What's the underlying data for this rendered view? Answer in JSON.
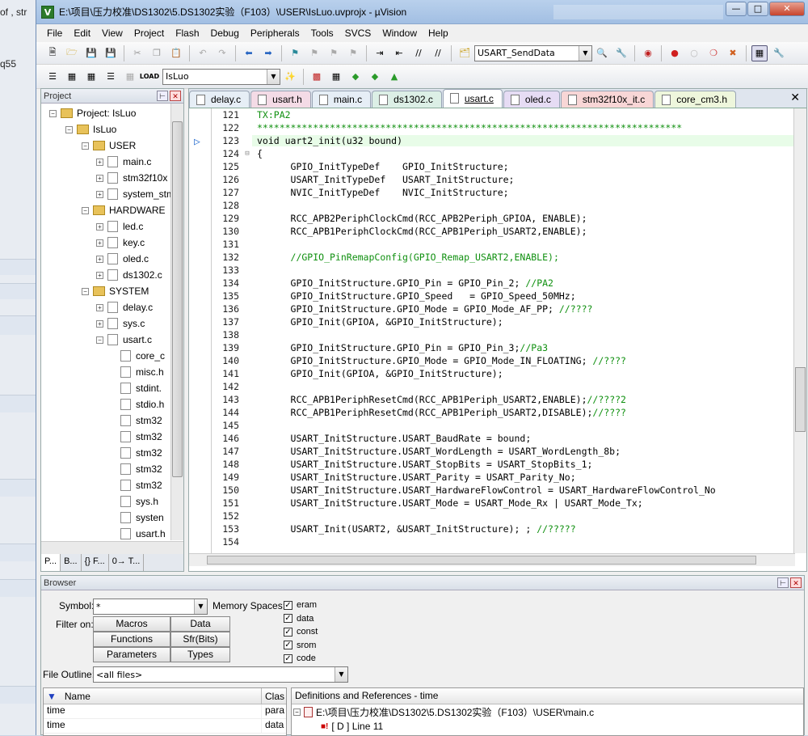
{
  "background": {
    "frag_of": "of , str",
    "frag_q55": "q55"
  },
  "title": "E:\\项目\\压力校准\\DS1302\\5.DS1302实验（F103）\\USER\\IsLuo.uvprojx - µVision",
  "menu": [
    "File",
    "Edit",
    "View",
    "Project",
    "Flash",
    "Debug",
    "Peripherals",
    "Tools",
    "SVCS",
    "Window",
    "Help"
  ],
  "toolbar": {
    "find_combo": "USART_SendData",
    "target_combo": "IsLuo"
  },
  "project_pane": {
    "title": "Project",
    "tree": [
      {
        "label": "Project: IsLuo",
        "level": 0,
        "kind": "project"
      },
      {
        "label": "IsLuo",
        "level": 1,
        "kind": "target"
      },
      {
        "label": "USER",
        "level": 2,
        "kind": "group"
      },
      {
        "label": "main.c",
        "level": 3,
        "kind": "file"
      },
      {
        "label": "stm32f10x",
        "level": 3,
        "kind": "file"
      },
      {
        "label": "system_stm",
        "level": 3,
        "kind": "file"
      },
      {
        "label": "HARDWARE",
        "level": 2,
        "kind": "group"
      },
      {
        "label": "led.c",
        "level": 3,
        "kind": "file"
      },
      {
        "label": "key.c",
        "level": 3,
        "kind": "file"
      },
      {
        "label": "oled.c",
        "level": 3,
        "kind": "file"
      },
      {
        "label": "ds1302.c",
        "level": 3,
        "kind": "file"
      },
      {
        "label": "SYSTEM",
        "level": 2,
        "kind": "group"
      },
      {
        "label": "delay.c",
        "level": 3,
        "kind": "file"
      },
      {
        "label": "sys.c",
        "level": 3,
        "kind": "file"
      },
      {
        "label": "usart.c",
        "level": 3,
        "kind": "file-open"
      },
      {
        "label": "core_c",
        "level": 4,
        "kind": "header"
      },
      {
        "label": "misc.h",
        "level": 4,
        "kind": "header"
      },
      {
        "label": "stdint.",
        "level": 4,
        "kind": "header"
      },
      {
        "label": "stdio.h",
        "level": 4,
        "kind": "header"
      },
      {
        "label": "stm32",
        "level": 4,
        "kind": "header"
      },
      {
        "label": "stm32",
        "level": 4,
        "kind": "header"
      },
      {
        "label": "stm32",
        "level": 4,
        "kind": "header"
      },
      {
        "label": "stm32",
        "level": 4,
        "kind": "header"
      },
      {
        "label": "stm32",
        "level": 4,
        "kind": "header"
      },
      {
        "label": "sys.h",
        "level": 4,
        "kind": "header"
      },
      {
        "label": "systen",
        "level": 4,
        "kind": "header"
      },
      {
        "label": "usart.h",
        "level": 4,
        "kind": "header"
      }
    ],
    "bottom_tabs": [
      "P...",
      "B...",
      "{} F...",
      "0→ T..."
    ]
  },
  "editor": {
    "tabs": [
      {
        "label": "delay.c",
        "color": "#e6eef6"
      },
      {
        "label": "usart.h",
        "color": "#f4dbe6"
      },
      {
        "label": "main.c",
        "color": "#e6eef6"
      },
      {
        "label": "ds1302.c",
        "color": "#dcefe6"
      },
      {
        "label": "usart.c",
        "color": "#ffffff",
        "active": true
      },
      {
        "label": "oled.c",
        "color": "#e6dcf4"
      },
      {
        "label": "stm32f10x_it.c",
        "color": "#f8d6d6"
      },
      {
        "label": "core_cm3.h",
        "color": "#eef6dc"
      }
    ],
    "lines": [
      {
        "n": "121",
        "t": "TX:PA2",
        "c": "cmt"
      },
      {
        "n": "122",
        "t": "****************************************************************************",
        "c": "cmt"
      },
      {
        "n": "123",
        "t": "void uart2_init(u32 bound)",
        "c": "",
        "hl": true
      },
      {
        "n": "124",
        "t": "{",
        "c": "",
        "fold": true
      },
      {
        "n": "125",
        "t": "      GPIO_InitTypeDef    GPIO_InitStructure;",
        "c": ""
      },
      {
        "n": "126",
        "t": "      USART_InitTypeDef   USART_InitStructure;",
        "c": ""
      },
      {
        "n": "127",
        "t": "      NVIC_InitTypeDef    NVIC_InitStructure;",
        "c": ""
      },
      {
        "n": "128",
        "t": "",
        "c": ""
      },
      {
        "n": "129",
        "t": "      RCC_APB2PeriphClockCmd(RCC_APB2Periph_GPIOA, ENABLE);",
        "c": ""
      },
      {
        "n": "130",
        "t": "      RCC_APB1PeriphClockCmd(RCC_APB1Periph_USART2,ENABLE);",
        "c": ""
      },
      {
        "n": "131",
        "t": "",
        "c": ""
      },
      {
        "n": "132",
        "t": "      //GPIO_PinRemapConfig(GPIO_Remap_USART2,ENABLE);",
        "c": "cmt"
      },
      {
        "n": "133",
        "t": "",
        "c": ""
      },
      {
        "n": "134",
        "t": "      GPIO_InitStructure.GPIO_Pin = GPIO_Pin_2; ",
        "c": "",
        "tail": "//PA2"
      },
      {
        "n": "135",
        "t": "      GPIO_InitStructure.GPIO_Speed   = GPIO_Speed_50MHz;",
        "c": ""
      },
      {
        "n": "136",
        "t": "      GPIO_InitStructure.GPIO_Mode = GPIO_Mode_AF_PP; ",
        "c": "",
        "tail": "//????"
      },
      {
        "n": "137",
        "t": "      GPIO_Init(GPIOA, &GPIO_InitStructure);",
        "c": ""
      },
      {
        "n": "138",
        "t": "",
        "c": ""
      },
      {
        "n": "139",
        "t": "      GPIO_InitStructure.GPIO_Pin = GPIO_Pin_3;",
        "c": "",
        "tail": "//Pa3"
      },
      {
        "n": "140",
        "t": "      GPIO_InitStructure.GPIO_Mode = GPIO_Mode_IN_FLOATING; ",
        "c": "",
        "tail": "//????"
      },
      {
        "n": "141",
        "t": "      GPIO_Init(GPIOA, &GPIO_InitStructure);",
        "c": ""
      },
      {
        "n": "142",
        "t": "",
        "c": ""
      },
      {
        "n": "143",
        "t": "      RCC_APB1PeriphResetCmd(RCC_APB1Periph_USART2,ENABLE);",
        "c": "",
        "tail": "//????2"
      },
      {
        "n": "144",
        "t": "      RCC_APB1PeriphResetCmd(RCC_APB1Periph_USART2,DISABLE);",
        "c": "",
        "tail": "//????"
      },
      {
        "n": "145",
        "t": "",
        "c": ""
      },
      {
        "n": "146",
        "t": "      USART_InitStructure.USART_BaudRate = bound;",
        "c": ""
      },
      {
        "n": "147",
        "t": "      USART_InitStructure.USART_WordLength = USART_WordLength_8b;",
        "c": ""
      },
      {
        "n": "148",
        "t": "      USART_InitStructure.USART_StopBits = USART_StopBits_1;",
        "c": ""
      },
      {
        "n": "149",
        "t": "      USART_InitStructure.USART_Parity = USART_Parity_No;",
        "c": ""
      },
      {
        "n": "150",
        "t": "      USART_InitStructure.USART_HardwareFlowControl = USART_HardwareFlowControl_No",
        "c": ""
      },
      {
        "n": "151",
        "t": "      USART_InitStructure.USART_Mode = USART_Mode_Rx | USART_Mode_Tx;",
        "c": ""
      },
      {
        "n": "152",
        "t": "",
        "c": ""
      },
      {
        "n": "153",
        "t": "      USART_Init(USART2, &USART_InitStructure); ; ",
        "c": "",
        "tail": "//?????"
      },
      {
        "n": "154",
        "t": "",
        "c": ""
      }
    ]
  },
  "browser": {
    "title": "Browser",
    "symbol_label": "Symbol:",
    "symbol_value": "*",
    "filter_label": "Filter on:",
    "filters": [
      "Macros",
      "Data",
      "Functions",
      "Sfr(Bits)",
      "Parameters",
      "Types"
    ],
    "memory_label": "Memory Spaces:",
    "memory": [
      "eram",
      "data",
      "const",
      "srom",
      "code"
    ],
    "outline_label": "File Outline:",
    "outline_value": "<all files>",
    "grid_headers": [
      "Name",
      "Clas"
    ],
    "grid_rows": [
      {
        "name": "time",
        "cls": "para"
      },
      {
        "name": "time",
        "cls": "data"
      }
    ],
    "defs_title": "Definitions and References - time",
    "defs_file": "E:\\项目\\压力校准\\DS1302\\5.DS1302实验（F103）\\USER\\main.c",
    "defs_line": "[ D ] Line 11"
  }
}
